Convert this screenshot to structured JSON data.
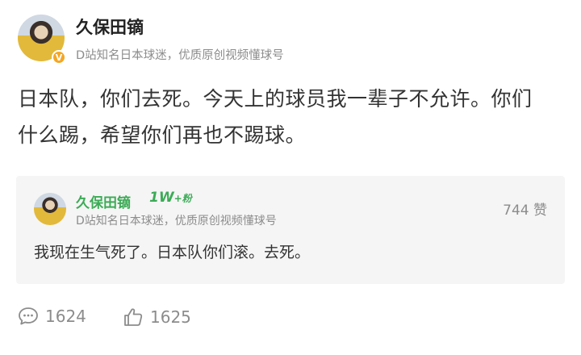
{
  "post": {
    "author": {
      "name": "久保田镝",
      "description": "D站知名日本球迷，优质原创视频懂球号",
      "verified_badge": "V"
    },
    "content": "日本队，你们去死。今天上的球员我一辈子不允许。你们什么踢，希望你们再也不踢球。"
  },
  "reply": {
    "author": {
      "name": "久保田镝",
      "fans_badge": "1W",
      "fans_badge_suffix": "+粉",
      "description": "D站知名日本球迷，优质原创视频懂球号"
    },
    "likes": "744 赞",
    "content": "我现在生气死了。日本队你们滚。去死。"
  },
  "actions": {
    "comments": "1624",
    "likes": "1625"
  },
  "colors": {
    "name_green": "#3cab56",
    "verified_orange": "#f5a623",
    "muted_gray": "#8c8c8c",
    "card_bg": "#f5f5f5"
  },
  "icons": [
    "comment-bubble-icon",
    "thumbs-up-icon",
    "verified-badge-icon"
  ]
}
